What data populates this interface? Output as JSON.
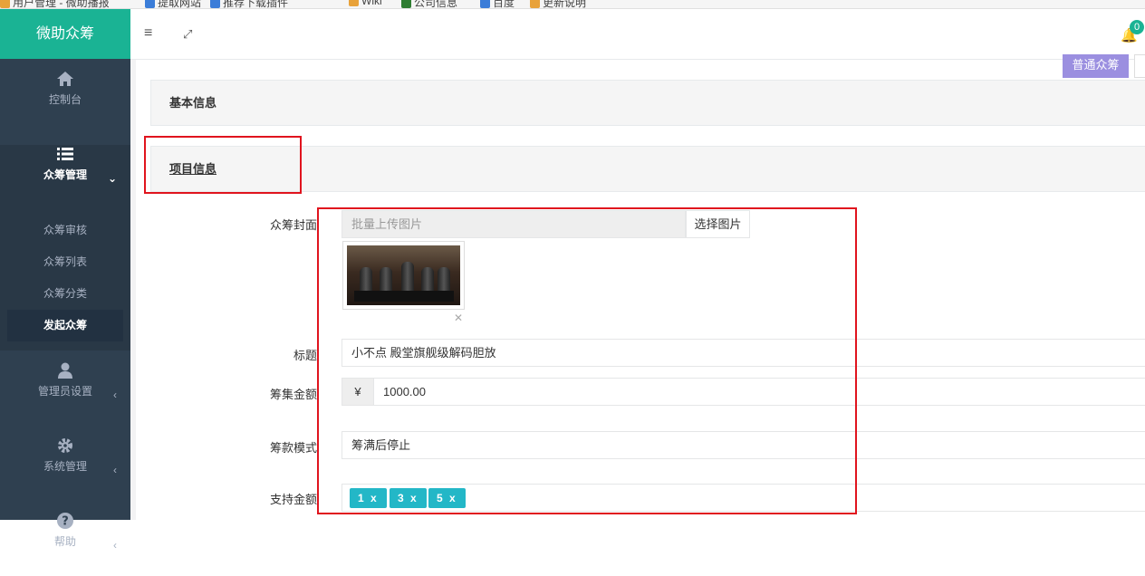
{
  "bookmarks": [
    "用户管理 - 微助播报",
    "提取网站",
    "推荐下载插件",
    "Wiki",
    "公司信息",
    "百度",
    "更新说明"
  ],
  "sidebar": {
    "brand": "微助众筹",
    "dashboard": "控制台",
    "crowd": "众筹管理",
    "submenu": [
      "众筹审核",
      "众筹列表",
      "众筹分类",
      "发起众筹"
    ],
    "admin": "管理员设置",
    "system": "系统管理",
    "help": "帮助"
  },
  "topbar": {
    "badge": "0"
  },
  "content": {
    "type_button": "普通众筹",
    "basic_info": "基本信息",
    "project_info": "项目信息",
    "cover_label": "众筹封面",
    "cover_placeholder": "批量上传图片",
    "cover_button": "选择图片",
    "title_label": "标题",
    "title_value": "小不点 殿堂旗舰级解码胆放",
    "amount_label": "筹集金额",
    "currency": "¥",
    "amount_value": "1000.00",
    "mode_label": "筹款模式",
    "mode_value": "筹满后停止",
    "support_label": "支持金额",
    "tags": [
      "1 x",
      "3 x",
      "5 x"
    ]
  },
  "colors": {
    "brand": "#1ab394",
    "sidebar": "#2f4050",
    "highlight": "#e0141e",
    "tag": "#23b7c7"
  }
}
